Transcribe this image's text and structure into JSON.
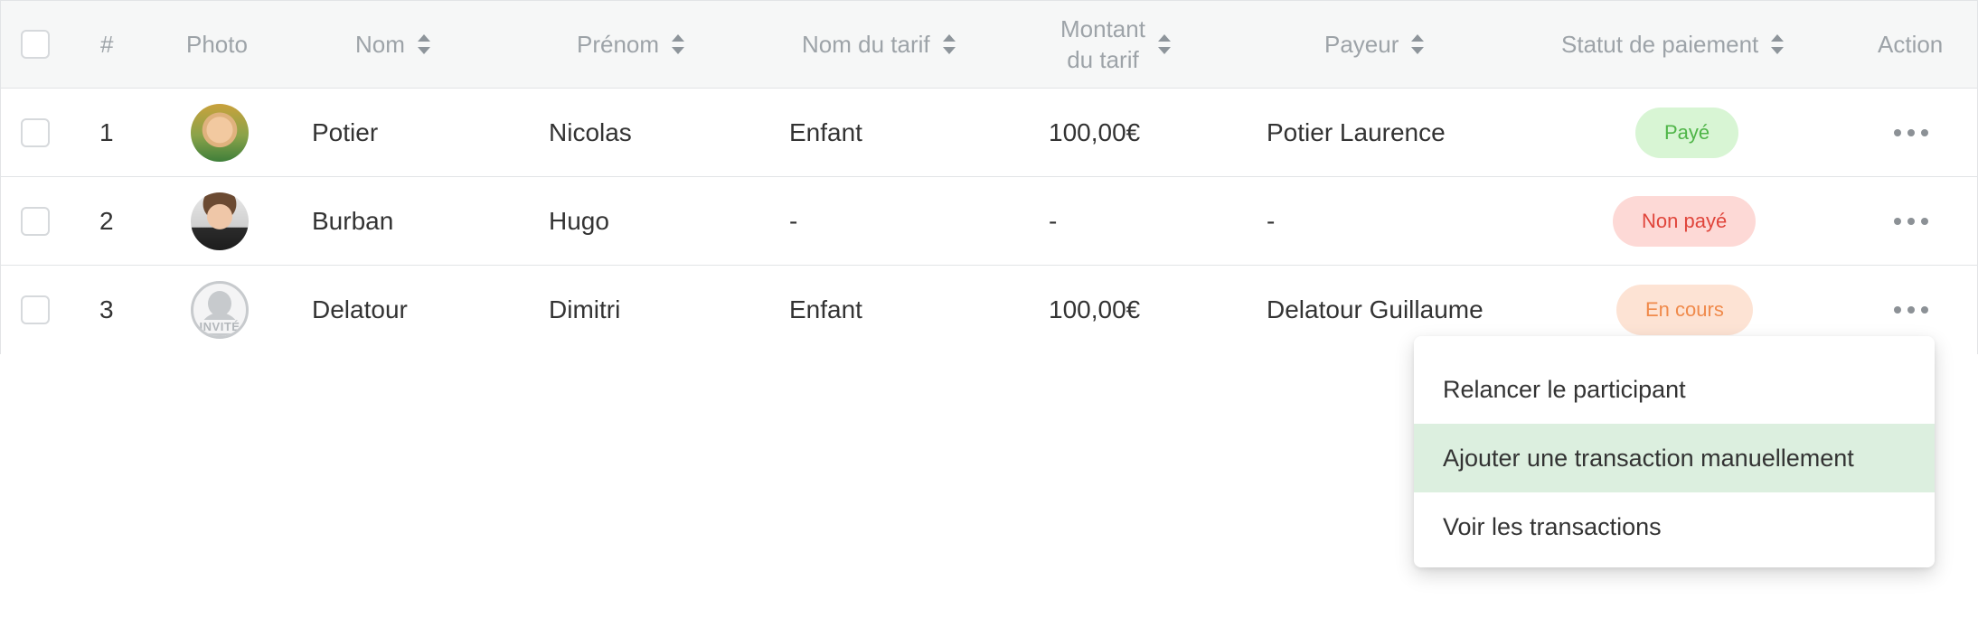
{
  "table": {
    "headers": {
      "index": "#",
      "photo": "Photo",
      "nom": "Nom",
      "prenom": "Prénom",
      "tarif_name": "Nom du tarif",
      "tarif_amount_line1": "Montant",
      "tarif_amount_line2": "du tarif",
      "payer": "Payeur",
      "payment_status": "Statut de paiement",
      "action": "Action"
    },
    "rows": [
      {
        "index": "1",
        "nom": "Potier",
        "prenom": "Nicolas",
        "tarif_name": "Enfant",
        "tarif_amount": "100,00€",
        "payer": "Potier Laurence",
        "status": "Payé",
        "status_color": "#4fb548"
      },
      {
        "index": "2",
        "nom": "Burban",
        "prenom": "Hugo",
        "tarif_name": "-",
        "tarif_amount": "-",
        "payer": "-",
        "status": "Non payé",
        "status_color": "#e0453b"
      },
      {
        "index": "3",
        "nom": "Delatour",
        "prenom": "Dimitri",
        "tarif_name": "Enfant",
        "tarif_amount": "100,00€",
        "payer": "Delatour Guillaume",
        "status": "En cours",
        "status_color": "#f08a4b",
        "photo_label": "INVITÉ"
      }
    ]
  },
  "action_menu": {
    "items": [
      {
        "label": "Relancer le participant"
      },
      {
        "label": "Ajouter une transaction manuellement",
        "highlighted": true
      },
      {
        "label": "Voir les transactions"
      }
    ]
  },
  "icons": {
    "sort": "sort-icon",
    "more": "more-horizontal-icon",
    "guest": "guest-avatar-icon"
  },
  "colors": {
    "header_bg": "#f6f7f7",
    "highlight_bg": "#dcefdf"
  }
}
